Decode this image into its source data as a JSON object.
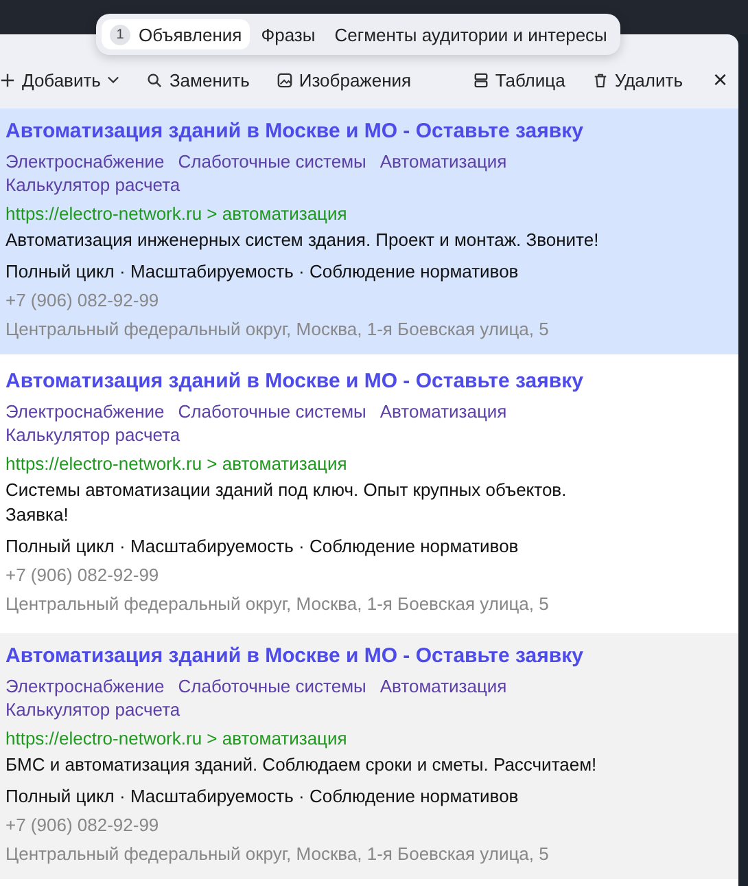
{
  "tabs": [
    {
      "label": "Объявления",
      "count": "1",
      "selected": true
    },
    {
      "label": "Фразы",
      "selected": false
    },
    {
      "label": "Сегменты аудитории и интересы",
      "selected": false
    }
  ],
  "toolbar": [
    {
      "kind": "add",
      "label": "Добавить"
    },
    {
      "kind": "replace",
      "label": "Заменить"
    },
    {
      "kind": "images",
      "label": "Изображения"
    },
    {
      "kind": "table",
      "label": "Таблица"
    },
    {
      "kind": "delete",
      "label": "Удалить"
    },
    {
      "kind": "close",
      "label": "×"
    }
  ],
  "ads": [
    {
      "selected": true,
      "highlighted": false,
      "title": "Автоматизация зданий в Москве и МО - Оставьте заявку",
      "sitelinks": [
        "Электроснабжение",
        "Слаботочные системы",
        "Автоматизация",
        "Калькулятор расчета"
      ],
      "url": "https://electro-network.ru > автоматизация",
      "text": "Автоматизация инженерных систем здания. Проект и монтаж. Звоните!",
      "callouts": "Полный цикл · Масштабируемость · Соблюдение нормативов",
      "phone": "+7 (906) 082-92-99",
      "address": "Центральный федеральный округ, Москва, 1-я Боевская улица, 5"
    },
    {
      "selected": false,
      "highlighted": false,
      "title": "Автоматизация зданий в Москве и МО - Оставьте заявку",
      "sitelinks": [
        "Электроснабжение",
        "Слаботочные системы",
        "Автоматизация",
        "Калькулятор расчета"
      ],
      "url": "https://electro-network.ru > автоматизация",
      "text": "Системы автоматизации зданий под ключ. Опыт крупных объектов. Заявка!",
      "callouts": "Полный цикл · Масштабируемость · Соблюдение нормативов",
      "phone": "+7 (906) 082-92-99",
      "address": "Центральный федеральный округ, Москва, 1-я Боевская улица, 5"
    },
    {
      "selected": false,
      "highlighted": true,
      "title": "Автоматизация зданий в Москве и МО - Оставьте заявку",
      "sitelinks": [
        "Электроснабжение",
        "Слаботочные системы",
        "Автоматизация",
        "Калькулятор расчета"
      ],
      "url": "https://electro-network.ru > автоматизация",
      "text": "БМС и автоматизация зданий. Соблюдаем сроки и сметы. Рассчитаем!",
      "callouts": "Полный цикл · Масштабируемость · Соблюдение нормативов",
      "phone": "+7 (906) 082-92-99",
      "address": "Центральный федеральный округ, Москва, 1-я Боевская улица, 5"
    }
  ]
}
